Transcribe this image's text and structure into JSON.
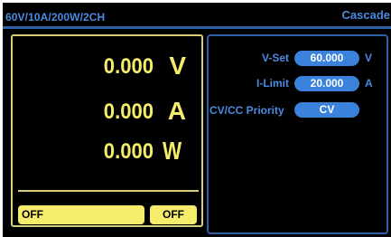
{
  "header": {
    "model": "60V/10A/200W/2CH",
    "mode": "Cascade"
  },
  "readings": [
    {
      "value": "0.000",
      "unit": "V"
    },
    {
      "value": "0.000",
      "unit": "A"
    },
    {
      "value": "0.000",
      "unit": "W"
    }
  ],
  "output": {
    "status_label": "OFF",
    "toggle_label": "OFF"
  },
  "settings": {
    "vset_label": "V-Set",
    "vset_value": "60.000",
    "vset_unit": "V",
    "ilimit_label": "I-Limit",
    "ilimit_value": "20.000",
    "ilimit_unit": "A",
    "priority_label": "CV/CC Priority",
    "priority_value": "CV"
  },
  "colors": {
    "header_text": "#4a8ae0",
    "reading_text": "#f4ec6a",
    "pill_bg": "#3a82dc",
    "left_border": "#d9cf7a",
    "right_border": "#2e60a8"
  }
}
